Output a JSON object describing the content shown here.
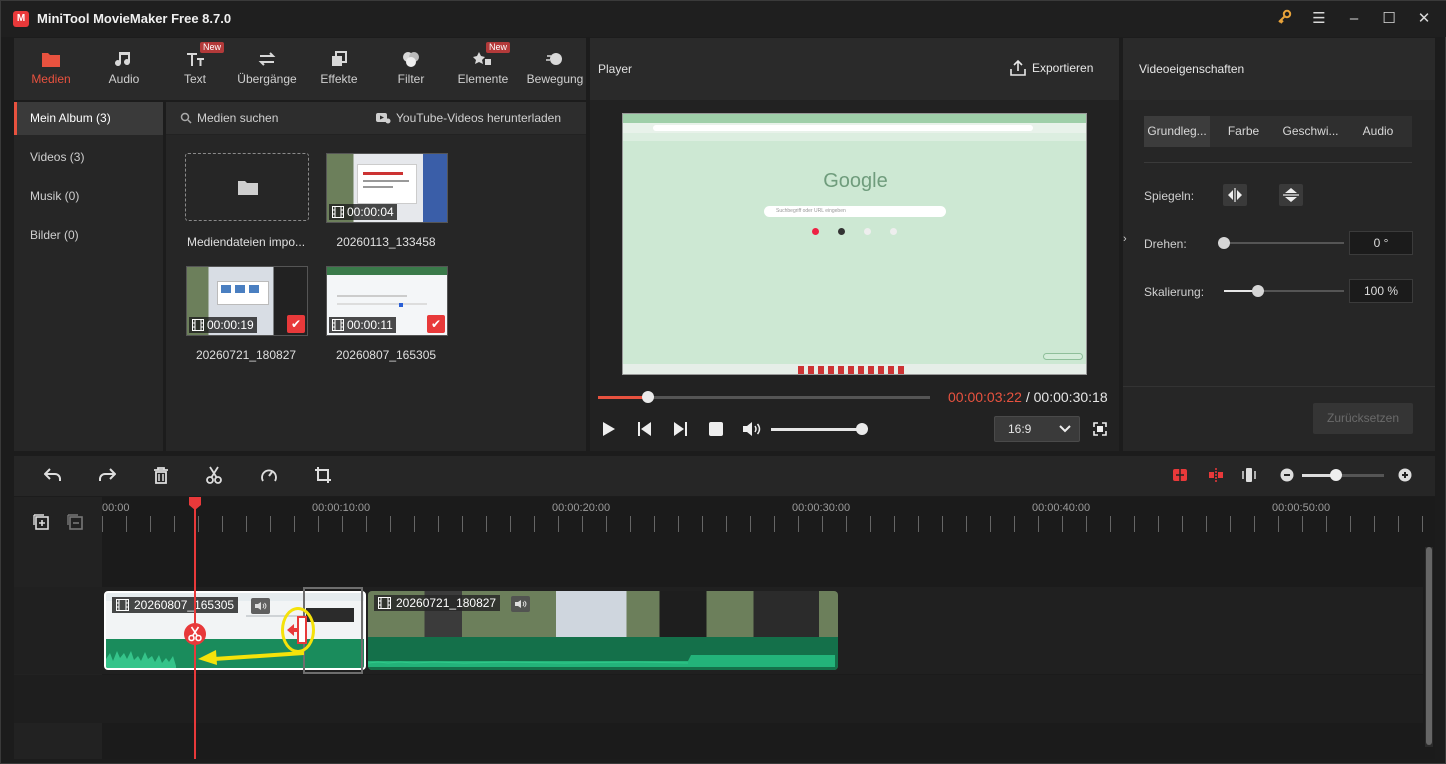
{
  "window": {
    "title": "MiniTool MovieMaker Free 8.7.0",
    "logo_letter": "M",
    "controls": [
      "key-icon",
      "menu-icon",
      "minimize-icon",
      "maximize-icon",
      "close-icon"
    ]
  },
  "toolbar": {
    "tabs": [
      {
        "label": "Medien",
        "icon": "media-folder-icon",
        "active": true
      },
      {
        "label": "Audio",
        "icon": "music-note-icon"
      },
      {
        "label": "Text",
        "icon": "text-icon",
        "badge": "New"
      },
      {
        "label": "Übergänge",
        "icon": "transition-arrows-icon"
      },
      {
        "label": "Effekte",
        "icon": "effects-icon"
      },
      {
        "label": "Filter",
        "icon": "filter-icon"
      },
      {
        "label": "Elemente",
        "icon": "elements-icon",
        "badge": "New"
      },
      {
        "label": "Bewegung",
        "icon": "motion-icon"
      }
    ]
  },
  "leftnav": {
    "items": [
      {
        "label": "Mein Album (3)",
        "active": true
      },
      {
        "label": "Videos (3)"
      },
      {
        "label": "Musik (0)"
      },
      {
        "label": "Bilder (0)"
      }
    ]
  },
  "media": {
    "search_label": "Medien suchen",
    "download_label": "YouTube-Videos herunterladen",
    "import_label": "Mediendateien impo...",
    "items": [
      {
        "name": "20260113_133458",
        "duration": "00:00:04",
        "checked": false
      },
      {
        "name": "20260721_180827",
        "duration": "00:00:19",
        "checked": true
      },
      {
        "name": "20260807_165305",
        "duration": "00:00:11",
        "checked": true
      }
    ]
  },
  "player": {
    "title": "Player",
    "export_label": "Exportieren",
    "current_time": "00:00:03:22",
    "separator": " / ",
    "total_time": "00:00:30:18",
    "aspect_ratio": "16:9",
    "progress_fraction": 0.15,
    "volume_fraction": 0.96,
    "screen_logo": "Google",
    "screen_search_placeholder": "Suchbegriff oder URL eingeben"
  },
  "properties": {
    "title": "Videoeigenschaften",
    "tabs": [
      "Grundleg...",
      "Farbe",
      "Geschwi...",
      "Audio"
    ],
    "mirror_label": "Spiegeln:",
    "rotate_label": "Drehen:",
    "rotate_value": "0 °",
    "rotate_fraction": 0.0,
    "scale_label": "Skalierung:",
    "scale_value": "100 %",
    "scale_fraction": 0.28,
    "reset_label": "Zurücksetzen"
  },
  "timeline": {
    "ruler_labels": [
      "00:00",
      "00:00:10:00",
      "00:00:20:00",
      "00:00:30:00",
      "00:00:40:00",
      "00:00:50:00"
    ],
    "zoom_fraction": 0.41,
    "clips": [
      {
        "name": "20260807_165305"
      },
      {
        "name": "20260721_180827"
      }
    ]
  },
  "colors": {
    "accent": "#e8523f",
    "playhead": "#e8393a",
    "audio_wave": "#1fa775",
    "highlight_yellow": "#f5e20a"
  }
}
